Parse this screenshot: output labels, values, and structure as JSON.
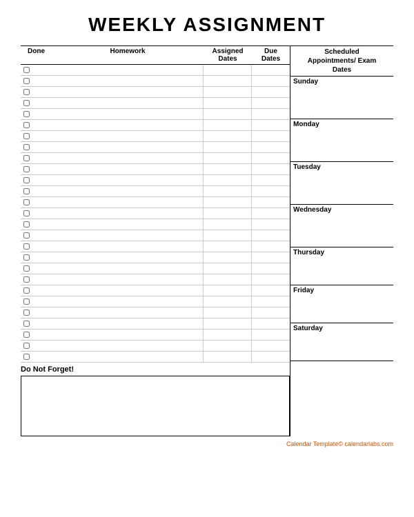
{
  "title": "WEEKLY ASSIGNMENT",
  "columns": {
    "done": "Done",
    "homework": "Homework",
    "assigned_dates": "Assigned\nDates",
    "due_dates": "Due\nDates",
    "scheduled": "Scheduled\nAppointments/ Exam\nDates"
  },
  "rows_count": 27,
  "do_not_forget_label": "Do Not Forget!",
  "days": [
    "Sunday",
    "Monday",
    "Tuesday",
    "Wednesday",
    "Thursday",
    "Friday",
    "Saturday"
  ],
  "footer": "Calendar Template© calendarlabs.com"
}
